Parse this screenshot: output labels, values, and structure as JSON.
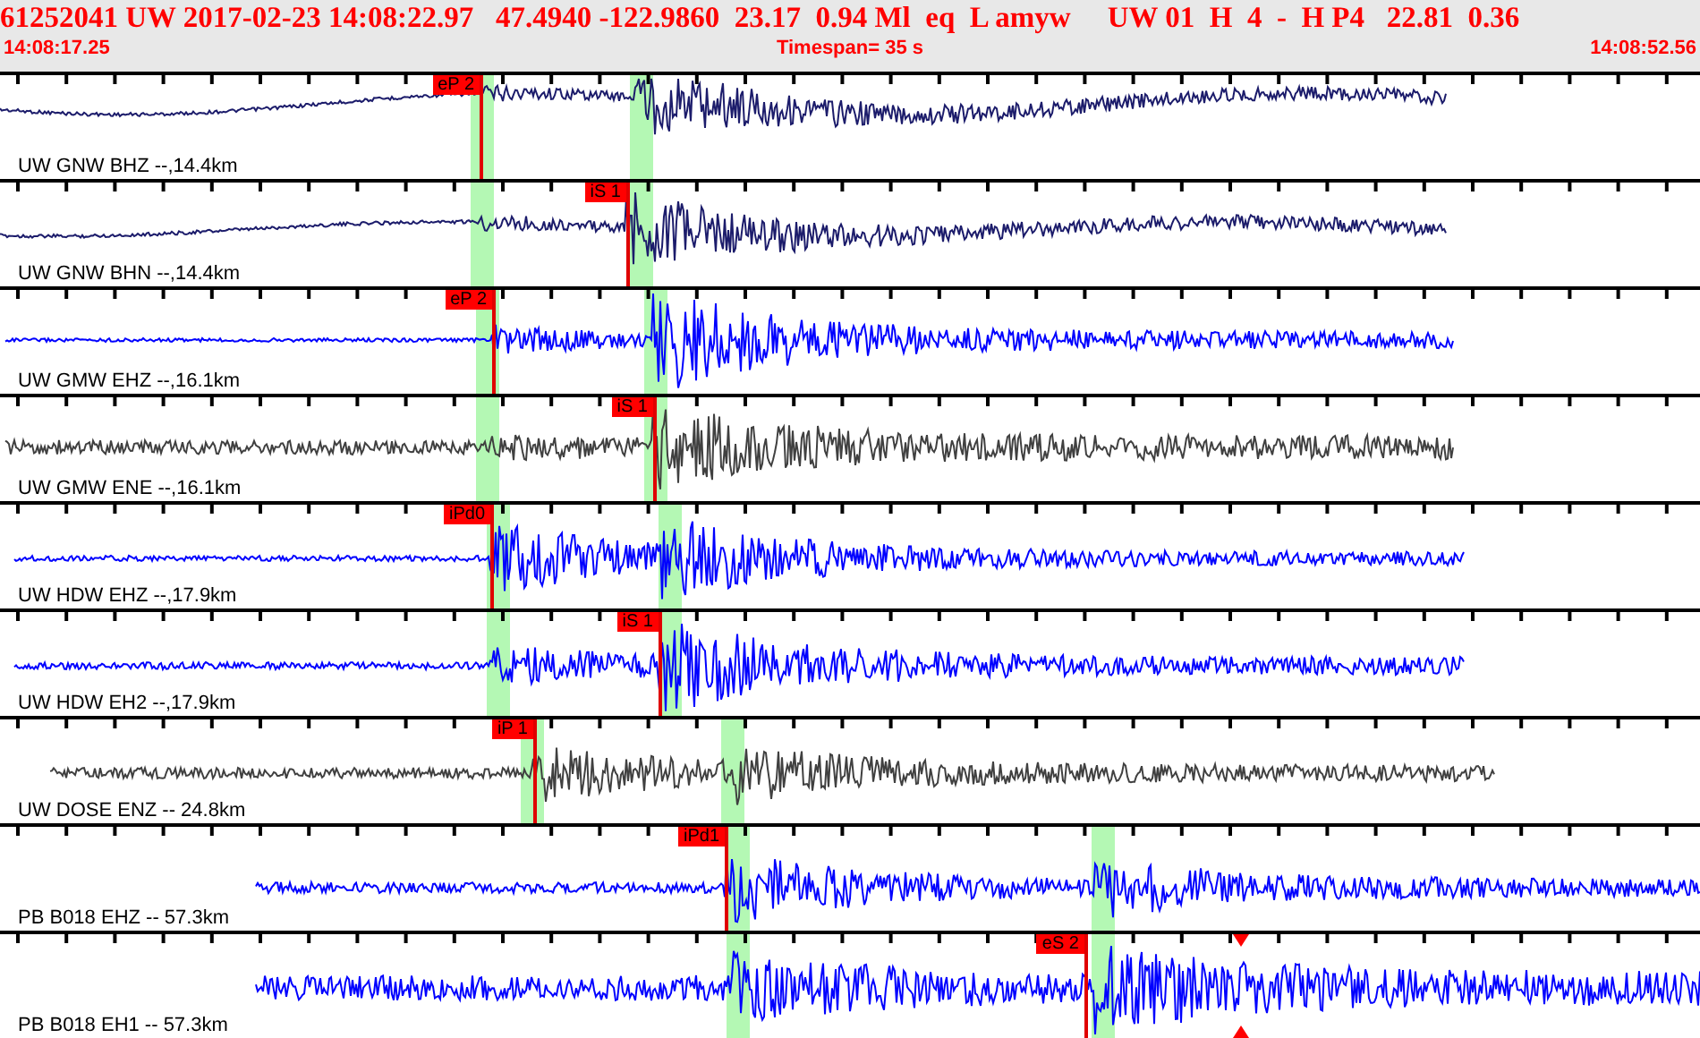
{
  "header": {
    "event_line": "61252041 UW 2017-02-23 14:08:22.97   47.4940 -122.9860  23.17  0.94 Ml  eq  L amyw     UW 01  H  4  -  H P4   22.81  0.36",
    "start_time": "14:08:17.25",
    "timespan": "Timespan=  35 s",
    "end_time": "14:08:52.56"
  },
  "traces": [
    {
      "label": "UW GNW BHZ --,14.4km",
      "color": "#1c1c6b",
      "picks": [
        {
          "label": "eP 2"
        }
      ]
    },
    {
      "label": "UW GNW BHN --,14.4km",
      "color": "#1c1c6b",
      "picks": [
        {
          "label": "iS 1"
        }
      ]
    },
    {
      "label": "UW GMW EHZ --,16.1km",
      "color": "#0000ff",
      "picks": [
        {
          "label": "eP 2"
        }
      ]
    },
    {
      "label": "UW GMW ENE --,16.1km",
      "color": "#404040",
      "picks": [
        {
          "label": "iS 1"
        }
      ]
    },
    {
      "label": "UW HDW EHZ --,17.9km",
      "color": "#0000ff",
      "picks": [
        {
          "label": "iPd0"
        }
      ]
    },
    {
      "label": "UW HDW EH2 --,17.9km",
      "color": "#0000ff",
      "picks": [
        {
          "label": "iS 1"
        }
      ]
    },
    {
      "label": "UW DOSE ENZ -- 24.8km",
      "color": "#404040",
      "picks": [
        {
          "label": "iP 1"
        }
      ]
    },
    {
      "label": "PB B018 EHZ -- 57.3km",
      "color": "#0000ff",
      "picks": [
        {
          "label": "iPd1"
        }
      ]
    },
    {
      "label": "PB B018 EH1 -- 57.3km",
      "color": "#0000ff",
      "picks": [
        {
          "label": "eS 2"
        }
      ]
    }
  ]
}
